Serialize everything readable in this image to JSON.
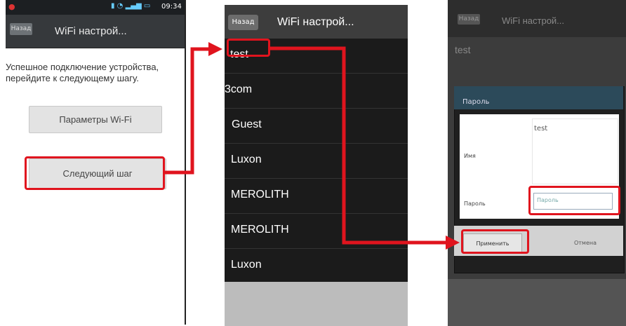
{
  "screen1": {
    "title": "WiFi настрой...",
    "back": "Назад",
    "message": "Успешное подключение устройства, перейдите к следующему шагу.",
    "wifi_params_button": "Параметры Wi-Fi",
    "next_step_button": "Следующий шаг",
    "status_time": "09:34"
  },
  "screen2": {
    "back": "Назад",
    "title": "WiFi настрой...",
    "networks": [
      "test",
      "3com",
      "Guest",
      "Luxon",
      "MEROLITH",
      "MEROLITH",
      "Luxon"
    ]
  },
  "screen3": {
    "back": "Назад",
    "title": "WiFi настрой...",
    "ssid_bg": "test",
    "dialog_title": "Пароль",
    "name_label": "Имя",
    "name_value": "test",
    "password_label": "Пароль",
    "password_placeholder": "Пароль",
    "apply_button": "Применить",
    "cancel_button": "Отмена"
  },
  "colors": {
    "highlight": "#e0141e",
    "dark_bg": "#1b1b1b",
    "titlebar": "#3d3d3d"
  }
}
